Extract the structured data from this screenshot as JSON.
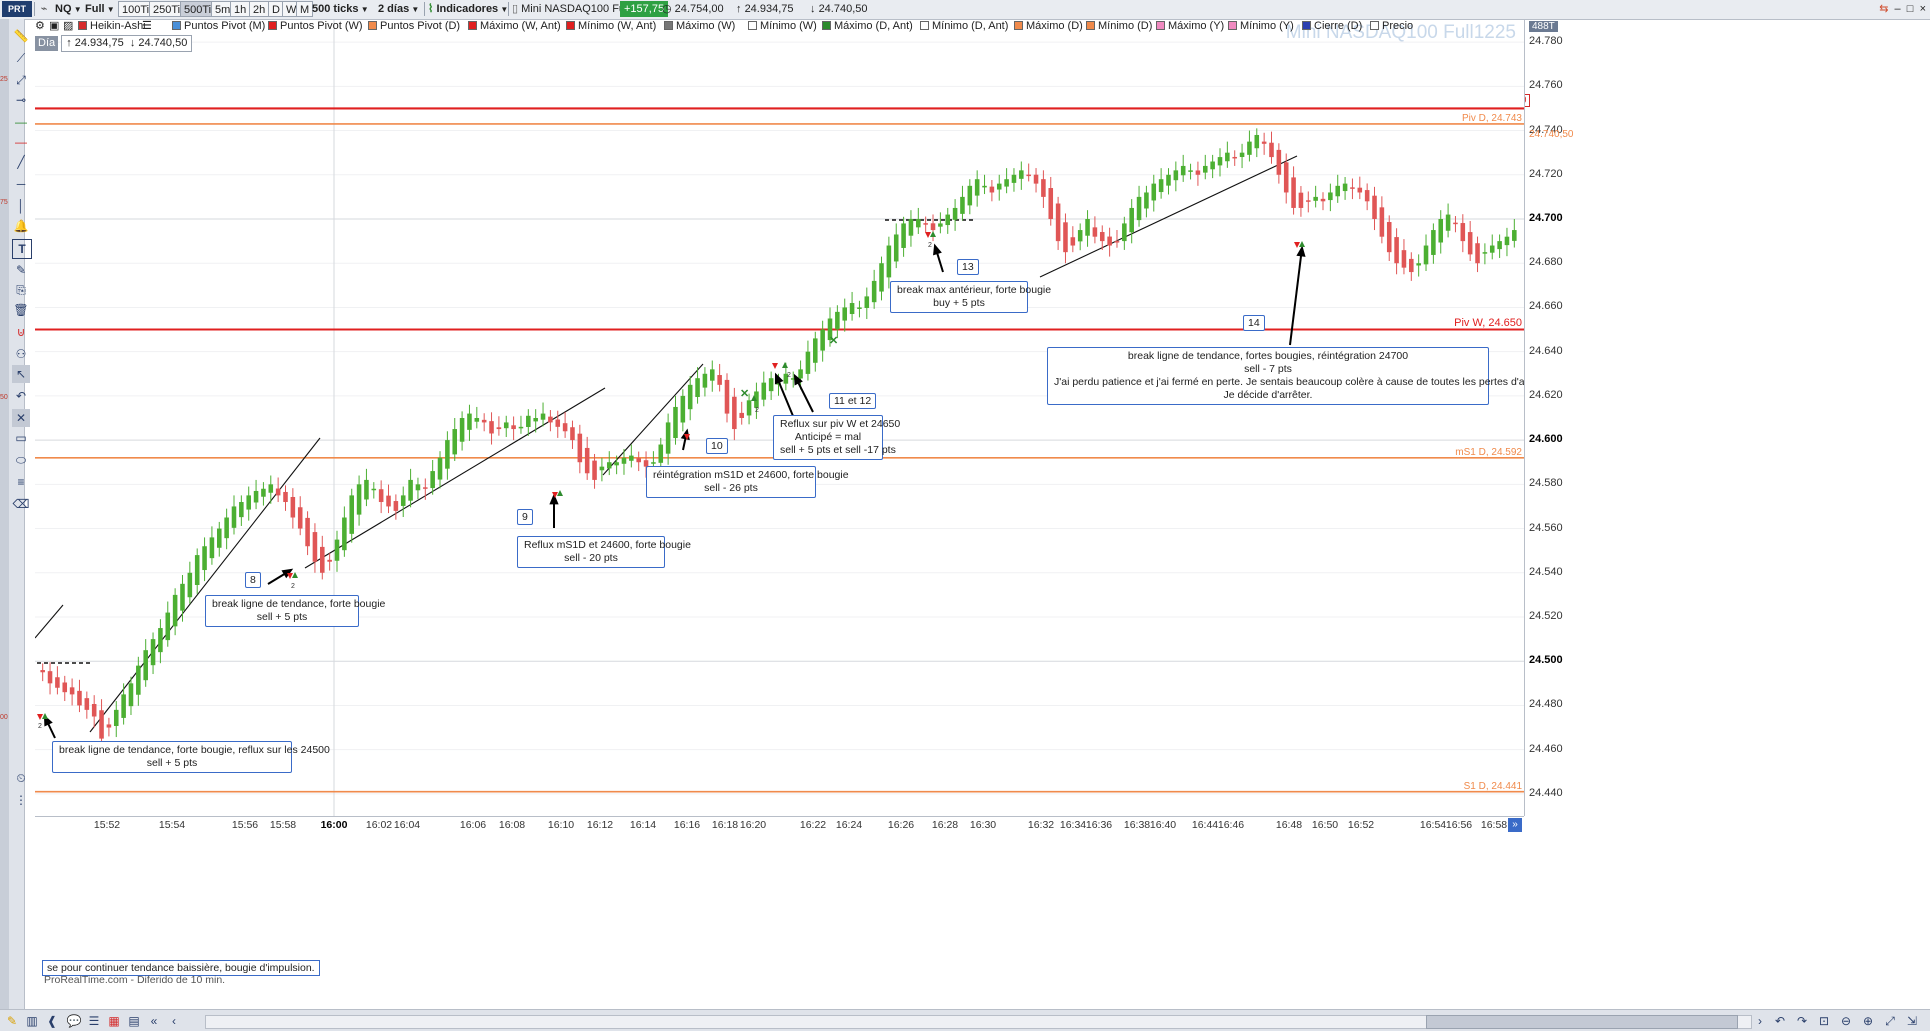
{
  "topbar": {
    "logo": "PRT",
    "ticker": "NQ",
    "session": "Full",
    "periods": [
      "100Ti",
      "250Ti",
      "500Ti",
      "5m",
      "1h",
      "2h",
      "D",
      "W",
      "M"
    ],
    "active_period": "500Ti",
    "ticks_select": "500 ticks",
    "duration_select": "2 días",
    "indicators_label": "Indicadores",
    "instrument": "Mini NASDAQ100 Full1225",
    "change_badge": "+157,75",
    "last_price": "24.754,00",
    "high_label": "24.934,75",
    "low_label": "24.740,50",
    "window_controls": [
      "–",
      "□",
      "×",
      "–",
      "□",
      "×"
    ]
  },
  "indicators": [
    {
      "label": "Heikin-Ashi",
      "color": "#d62c2c"
    },
    {
      "label": "Puntos Pivot (M)",
      "color": "#4a90d9"
    },
    {
      "label": "Puntos Pivot (W)",
      "color": "#e02020"
    },
    {
      "label": "Puntos Pivot (D)",
      "color": "#f08a4b"
    },
    {
      "label": "Máximo (W, Ant)",
      "color": "#e02020"
    },
    {
      "label": "Mínimo (W, Ant)",
      "color": "#e02020"
    },
    {
      "label": "Máximo (W)",
      "color": "#777777"
    },
    {
      "label": "Mínimo (W)",
      "color": "#ffffff"
    },
    {
      "label": "Máximo (D, Ant)",
      "color": "#2e8b2e"
    },
    {
      "label": "Mínimo (D, Ant)",
      "color": "#ffffff"
    },
    {
      "label": "Máximo (D)",
      "color": "#f08a4b"
    },
    {
      "label": "Mínimo (D)",
      "color": "#f08a4b"
    },
    {
      "label": "Máximo (Y)",
      "color": "#f08ac0"
    },
    {
      "label": "Mínimo (Y)",
      "color": "#f08ac0"
    },
    {
      "label": "Cierre (D)",
      "color": "#2b3fb0"
    },
    {
      "label": "Precio",
      "color": "#ffffff"
    }
  ],
  "ohlc": {
    "period": "Día",
    "high": "24.934,75",
    "low": "24.740,50"
  },
  "watermark": "Mini NASDAQ100 Full1225",
  "yaxis": {
    "ticks": [
      "24.780",
      "24.760",
      "24.740",
      "24.720",
      "24.700",
      "24.680",
      "24.660",
      "24.640",
      "24.620",
      "24.600",
      "24.580",
      "24.560",
      "24.540",
      "24.520",
      "24.500",
      "24.480",
      "24.460",
      "24.440"
    ],
    "bold_ticks": [
      "24.700",
      "24.600",
      "24.500"
    ],
    "top_badge": "488T",
    "price_box_red": "24.750,00",
    "price_label_orange": "24.740,50"
  },
  "levels": [
    {
      "label": "Piv D, 24.743",
      "value": 24743,
      "color": "#f08a4b"
    },
    {
      "label": "Piv W, 24.650",
      "value": 24650,
      "color": "#e02020"
    },
    {
      "label": "mS1 D, 24.592",
      "value": 24592,
      "color": "#f08a4b"
    },
    {
      "label": "S1 D, 24.441",
      "value": 24441,
      "color": "#f08a4b"
    }
  ],
  "red_line_value": 24750,
  "xaxis": {
    "ticks": [
      "15:52",
      "15:54",
      "15:56",
      "15:58",
      "16:00",
      "16:02",
      "16:04",
      "16:06",
      "16:08",
      "16:10",
      "16:12",
      "16:14",
      "16:16",
      "16:18",
      "16:20",
      "16:22",
      "16:24",
      "16:26",
      "16:28",
      "16:30",
      "16:32",
      "16:34",
      "16:36",
      "16:38",
      "16:40",
      "16:44",
      "16:46",
      "16:48",
      "16:50",
      "16:52",
      "16:54",
      "16:56",
      "16:58"
    ],
    "bold_tick": "16:00"
  },
  "annotations": [
    {
      "num": "8",
      "lines": [
        "break ligne de tendance, forte bougie",
        "sell + 5 pts"
      ]
    },
    {
      "num": "9",
      "lines": [
        "Reflux mS1D et 24600, forte bougie",
        "sell - 20 pts"
      ]
    },
    {
      "num": "10",
      "lines": [
        "réintégration mS1D et 24600, forte bougie",
        "sell - 26 pts"
      ]
    },
    {
      "num": "11 et 12",
      "lines": [
        "Reflux sur piv W et 24650",
        "Anticipé = mal",
        "sell + 5 pts et sell -17 pts"
      ]
    },
    {
      "num": "13",
      "lines": [
        "break max antérieur, forte bougie",
        "buy + 5 pts"
      ]
    },
    {
      "num": "14",
      "lines": [
        "break ligne de tendance, fortes bougies, réintégration 24700",
        "sell - 7 pts",
        "J'ai perdu patience et j'ai fermé en perte. Je sentais beaucoup colère à cause de toutes les pertes d'aujoud'hui.",
        "Je décide d'arrêter."
      ]
    },
    {
      "num": "",
      "lines": [
        "break ligne de tendance, forte bougie, reflux sur les 24500",
        "sell + 5 pts"
      ]
    }
  ],
  "footer_note": "se pour continuer tendance baissière, bougie d'impulsion.",
  "footer_credit": "ProRealTime.com - Diferido de 10 min.",
  "marker_digit": "2",
  "chart_data": {
    "type": "candlestick",
    "style": "Heikin-Ashi",
    "ylim": [
      24430,
      24790
    ],
    "x_start": "15:50",
    "x_end": "16:59",
    "closes": [
      24495,
      24490,
      24488,
      24486,
      24485,
      24480,
      24478,
      24475,
      24465,
      24470,
      24478,
      24485,
      24490,
      24498,
      24505,
      24510,
      24515,
      24522,
      24530,
      24535,
      24540,
      24548,
      24552,
      24556,
      24560,
      24565,
      24570,
      24572,
      24575,
      24577,
      24578,
      24580,
      24575,
      24572,
      24565,
      24560,
      24552,
      24545,
      24540,
      24545,
      24555,
      24565,
      24575,
      24580,
      24582,
      24578,
      24572,
      24570,
      24568,
      24575,
      24582,
      24580,
      24578,
      24586,
      24592,
      24600,
      24605,
      24610,
      24612,
      24610,
      24608,
      24603,
      24605,
      24608,
      24605,
      24606,
      24611,
      24610,
      24612,
      24608,
      24606,
      24604,
      24600,
      24590,
      24585,
      24582,
      24588,
      24590,
      24590,
      24592,
      24593,
      24590,
      24588,
      24590,
      24598,
      24608,
      24615,
      24620,
      24625,
      24628,
      24630,
      24632,
      24625,
      24612,
      24605,
      24610,
      24618,
      24622,
      24626,
      24628,
      24626,
      24630,
      24628,
      24632,
      24640,
      24646,
      24650,
      24655,
      24658,
      24660,
      24662,
      24660,
      24665,
      24672,
      24680,
      24688,
      24693,
      24698,
      24700,
      24700,
      24698,
      24695,
      24698,
      24702,
      24705,
      24710,
      24715,
      24718,
      24715,
      24712,
      24716,
      24718,
      24720,
      24722,
      24720,
      24716,
      24710,
      24700,
      24690,
      24685,
      24688,
      24695,
      24700,
      24692,
      24690,
      24688,
      24690,
      24698,
      24705,
      24710,
      24712,
      24716,
      24718,
      24720,
      24722,
      24724,
      24722,
      24720,
      24724,
      24726,
      24728,
      24730,
      24728,
      24730,
      24735,
      24738,
      24734,
      24728,
      24720,
      24712,
      24705,
      24705,
      24708,
      24710,
      24708,
      24712,
      24715,
      24716,
      24714,
      24712,
      24708,
      24700,
      24692,
      24685,
      24680,
      24678,
      24676,
      24680,
      24688,
      24695,
      24700,
      24702,
      24698,
      24690,
      24684,
      24680,
      24685,
      24688,
      24690,
      24692,
      24695
    ],
    "levels": [
      24750,
      24743,
      24650,
      24592,
      24441
    ]
  }
}
